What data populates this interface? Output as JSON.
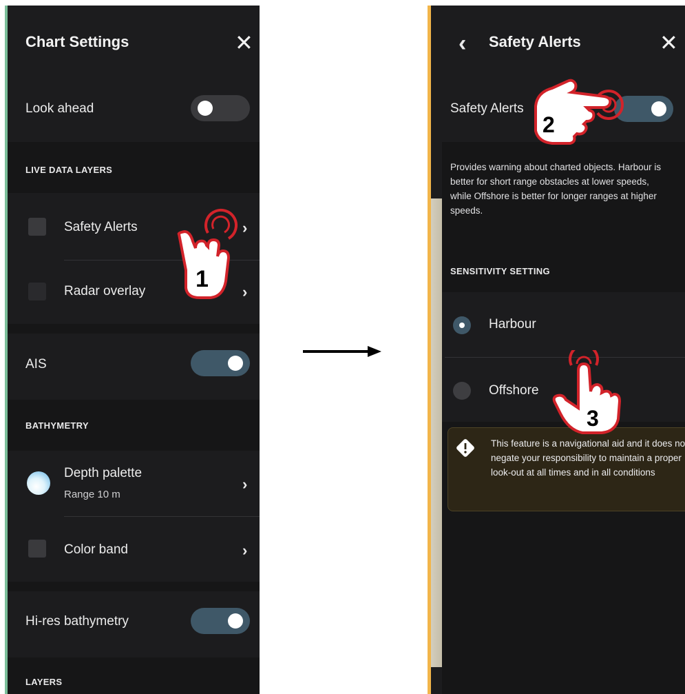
{
  "left": {
    "title": "Chart Settings",
    "close": "✕",
    "look_ahead": {
      "label": "Look ahead",
      "on": false
    },
    "sections": {
      "live": "LIVE DATA LAYERS",
      "bathymetry": "BATHYMETRY",
      "layers": "LAYERS"
    },
    "safety_alerts": {
      "label": "Safety Alerts"
    },
    "radar_overlay": {
      "label": "Radar overlay"
    },
    "ais": {
      "label": "AIS",
      "on": true
    },
    "depth_palette": {
      "label": "Depth palette",
      "sub": "Range 10 m"
    },
    "color_band": {
      "label": "Color band"
    },
    "hi_res": {
      "label": "Hi-res bathymetry",
      "on": true
    },
    "chevron": "›"
  },
  "right": {
    "back": "‹",
    "title": "Safety Alerts",
    "close": "✕",
    "safety_alerts": {
      "label": "Safety Alerts",
      "on": true
    },
    "description": "Provides warning about charted objects. Harbour is better for short range obstacles at lower speeds, while Offshore is better for longer ranges at higher speeds.",
    "sensitivity_header": "SENSITIVITY SETTING",
    "options": [
      {
        "label": "Harbour",
        "selected": true
      },
      {
        "label": "Offshore",
        "selected": false
      }
    ],
    "warning": "This feature is a navigational aid and it does not negate your responsibility to maintain a proper look-out at all times and in all conditions"
  },
  "annotations": {
    "step1": "1",
    "step2": "2",
    "step3": "3"
  },
  "colors": {
    "accent_left": "#7bbf9a",
    "accent_right": "#f2b54a",
    "toggle_on": "#3f5868",
    "hand_red": "#d2232a"
  }
}
